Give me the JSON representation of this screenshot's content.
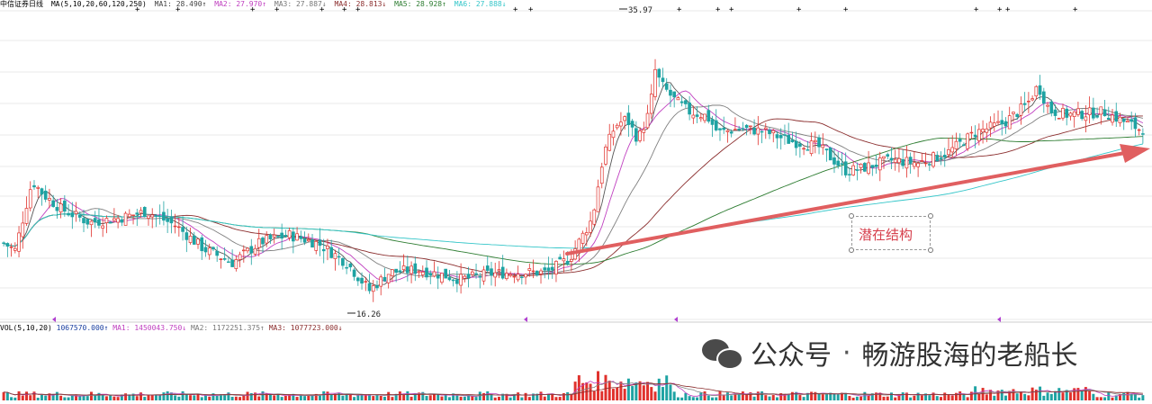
{
  "header": {
    "stock_name": "中信证券日线",
    "ma_params": "MA(5,10,20,60,120,250)",
    "ma1": "MA1: 28.490↑",
    "ma2": "MA2: 27.970↑",
    "ma3": "MA3: 27.887↓",
    "ma4": "MA4: 28.813↓",
    "ma5": "MA5: 28.928↑",
    "ma6": "MA6: 27.888↓"
  },
  "volume_header": {
    "params": "VOL(5,10,20)",
    "value": "1067570.000↑",
    "ma1": "MA1: 1450043.750↓",
    "ma2": "MA2: 1172251.375↑",
    "ma3": "MA3: 1077723.000↓"
  },
  "annotation": {
    "text": "潜在结构"
  },
  "watermark": {
    "label": "公众号",
    "dot": "·",
    "name": "畅游股海的老船长"
  },
  "colors": {
    "up": "#e0312c",
    "down": "#1ea3a3",
    "ma1": "#555555",
    "ma2": "#c040c0",
    "ma3": "#808080",
    "ma4": "#8b2e2e",
    "ma5": "#2e7d32",
    "ma6": "#35c6c9",
    "arrow": "#e05f60",
    "grid": "#d6d6d6"
  },
  "chart_data": {
    "type": "candlestick",
    "high_label": "35.97",
    "low_label": "16.26",
    "price_range": [
      14.5,
      36.8
    ],
    "key_points": [
      {
        "label": "16.26",
        "price": 16.26
      },
      {
        "label": "35.97",
        "price": 35.97
      }
    ]
  }
}
